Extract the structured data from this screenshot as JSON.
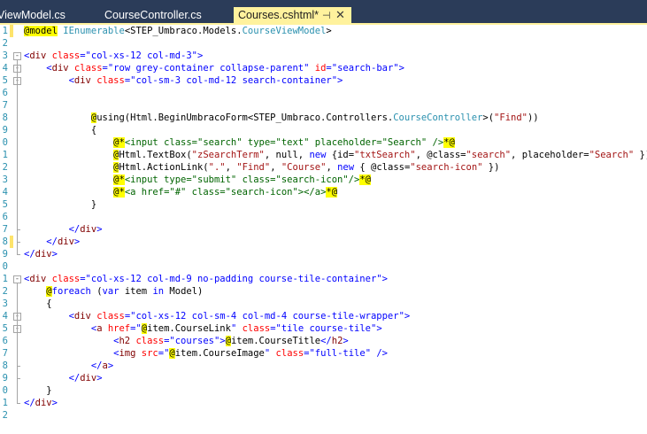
{
  "tabs": [
    {
      "label": "ViewModel.cs",
      "active": false
    },
    {
      "label": "CourseController.cs",
      "active": false
    },
    {
      "label": "Courses.cshtml*",
      "active": true
    }
  ],
  "tab_controls": {
    "pin": "⊣",
    "close": "✕"
  },
  "colors": {
    "tabbar": "#2b3c59",
    "active_tab": "#fff29d",
    "line_numbers": "#2b91af",
    "tag": "#800000",
    "attribute": "#ff0000",
    "attribute_value": "#0000ff",
    "string": "#a31515",
    "type": "#2b91af",
    "razor_highlight": "#ffff00",
    "modified_marker": "#fee46b"
  },
  "lines": [
    {
      "n": "1",
      "mod": true,
      "fold": "",
      "tokens": [
        [
          "rz",
          "@model"
        ],
        [
          "",
          " "
        ],
        [
          "ty",
          "IEnumerable"
        ],
        [
          "",
          "<STEP_Umbraco.Models."
        ],
        [
          "ty",
          "CourseViewModel"
        ],
        [
          "",
          ">"
        ]
      ]
    },
    {
      "n": "2",
      "mod": false,
      "fold": "",
      "tokens": []
    },
    {
      "n": "3",
      "mod": false,
      "fold": "-",
      "tokens": [
        [
          "av",
          "<"
        ],
        [
          "tg",
          "div"
        ],
        [
          "",
          " "
        ],
        [
          "at",
          "class"
        ],
        [
          "av",
          "=\"col-xs-12 col-md-3\">"
        ]
      ]
    },
    {
      "n": "4",
      "mod": false,
      "fold": "-",
      "tokens": [
        [
          "",
          "    "
        ],
        [
          "av",
          "<"
        ],
        [
          "tg",
          "div"
        ],
        [
          "",
          " "
        ],
        [
          "at",
          "class"
        ],
        [
          "av",
          "=\"row grey-container collapse-parent\""
        ],
        [
          "",
          " "
        ],
        [
          "at",
          "id"
        ],
        [
          "av",
          "=\"search-bar\">"
        ]
      ]
    },
    {
      "n": "5",
      "mod": false,
      "fold": "-",
      "tokens": [
        [
          "",
          "        "
        ],
        [
          "av",
          "<"
        ],
        [
          "tg",
          "div"
        ],
        [
          "",
          " "
        ],
        [
          "at",
          "class"
        ],
        [
          "av",
          "=\"col-sm-3 col-md-12 search-container\">"
        ]
      ]
    },
    {
      "n": "6",
      "mod": false,
      "fold": "",
      "tokens": []
    },
    {
      "n": "7",
      "mod": false,
      "fold": "",
      "tokens": []
    },
    {
      "n": "8",
      "mod": false,
      "fold": "",
      "tokens": [
        [
          "",
          "            "
        ],
        [
          "rz",
          "@"
        ],
        [
          "",
          "using(Html.BeginUmbracoForm<STEP_Umbraco.Controllers."
        ],
        [
          "ty",
          "CourseController"
        ],
        [
          "",
          ">("
        ],
        [
          "st",
          "\"Find\""
        ],
        [
          "",
          "))"
        ]
      ]
    },
    {
      "n": "9",
      "mod": false,
      "fold": "",
      "tokens": [
        [
          "",
          "            {"
        ]
      ]
    },
    {
      "n": "0",
      "mod": false,
      "fold": "",
      "tokens": [
        [
          "",
          "                "
        ],
        [
          "rz",
          "@*"
        ],
        [
          "cm",
          "<input class=\"search\" type=\"text\" placeholder=\"Search\" />"
        ],
        [
          "rz",
          "*@"
        ]
      ]
    },
    {
      "n": "1",
      "mod": false,
      "fold": "",
      "tokens": [
        [
          "",
          "                "
        ],
        [
          "rz",
          "@"
        ],
        [
          "",
          "Html.TextBox("
        ],
        [
          "st",
          "\"zSearchTerm\""
        ],
        [
          "",
          ", null, "
        ],
        [
          "av",
          "new"
        ],
        [
          "",
          " {id="
        ],
        [
          "st",
          "\"txtSearch\""
        ],
        [
          "",
          ", @class="
        ],
        [
          "st",
          "\"search\""
        ],
        [
          "",
          ", placeholder="
        ],
        [
          "st",
          "\"Search\""
        ],
        [
          "",
          " })"
        ]
      ]
    },
    {
      "n": "2",
      "mod": false,
      "fold": "",
      "tokens": [
        [
          "",
          "                "
        ],
        [
          "rz",
          "@"
        ],
        [
          "",
          "Html.ActionLink("
        ],
        [
          "st",
          "\".\""
        ],
        [
          "",
          ", "
        ],
        [
          "st",
          "\"Find\""
        ],
        [
          "",
          ", "
        ],
        [
          "st",
          "\"Course\""
        ],
        [
          "",
          ", "
        ],
        [
          "av",
          "new"
        ],
        [
          "",
          " { @class="
        ],
        [
          "st",
          "\"search-icon\""
        ],
        [
          "",
          " })"
        ]
      ]
    },
    {
      "n": "3",
      "mod": false,
      "fold": "",
      "tokens": [
        [
          "",
          "                "
        ],
        [
          "rz",
          "@*"
        ],
        [
          "cm",
          "<input type=\"submit\" class=\"search-icon\"/>"
        ],
        [
          "rz",
          "*@"
        ]
      ]
    },
    {
      "n": "4",
      "mod": false,
      "fold": "",
      "tokens": [
        [
          "",
          "                "
        ],
        [
          "rz",
          "@*"
        ],
        [
          "cm",
          "<a href=\"#\" class=\"search-icon\"></a>"
        ],
        [
          "rz",
          "*@"
        ]
      ]
    },
    {
      "n": "5",
      "mod": false,
      "fold": "",
      "tokens": [
        [
          "",
          "            }"
        ]
      ]
    },
    {
      "n": "6",
      "mod": false,
      "fold": "",
      "tokens": []
    },
    {
      "n": "7",
      "mod": false,
      "fold": "",
      "tokens": [
        [
          "",
          "        "
        ],
        [
          "av",
          "</"
        ],
        [
          "tg",
          "div"
        ],
        [
          "av",
          ">"
        ]
      ]
    },
    {
      "n": "8",
      "mod": true,
      "fold": "",
      "tokens": [
        [
          "",
          "    "
        ],
        [
          "av",
          "</"
        ],
        [
          "tg",
          "div"
        ],
        [
          "av",
          ">"
        ]
      ]
    },
    {
      "n": "9",
      "mod": false,
      "fold": "",
      "tokens": [
        [
          "av",
          "</"
        ],
        [
          "tg",
          "div"
        ],
        [
          "av",
          ">"
        ]
      ]
    },
    {
      "n": "0",
      "mod": false,
      "fold": "",
      "tokens": []
    },
    {
      "n": "1",
      "mod": false,
      "fold": "-",
      "tokens": [
        [
          "av",
          "<"
        ],
        [
          "tg",
          "div"
        ],
        [
          "",
          " "
        ],
        [
          "at",
          "class"
        ],
        [
          "av",
          "=\"col-xs-12 col-md-9 no-padding course-tile-container\">"
        ]
      ]
    },
    {
      "n": "2",
      "mod": false,
      "fold": "",
      "tokens": [
        [
          "",
          "    "
        ],
        [
          "rz",
          "@"
        ],
        [
          "av",
          "foreach"
        ],
        [
          "",
          " ("
        ],
        [
          "av",
          "var"
        ],
        [
          "",
          " item "
        ],
        [
          "av",
          "in"
        ],
        [
          "",
          " Model)"
        ]
      ]
    },
    {
      "n": "3",
      "mod": false,
      "fold": "",
      "tokens": [
        [
          "",
          "    {"
        ]
      ]
    },
    {
      "n": "4",
      "mod": false,
      "fold": "-",
      "tokens": [
        [
          "",
          "        "
        ],
        [
          "av",
          "<"
        ],
        [
          "tg",
          "div"
        ],
        [
          "",
          " "
        ],
        [
          "at",
          "class"
        ],
        [
          "av",
          "=\"col-xs-12 col-sm-4 col-md-4 course-tile-wrapper\">"
        ]
      ]
    },
    {
      "n": "5",
      "mod": false,
      "fold": "-",
      "tokens": [
        [
          "",
          "            "
        ],
        [
          "av",
          "<"
        ],
        [
          "tg",
          "a"
        ],
        [
          "",
          " "
        ],
        [
          "at",
          "href"
        ],
        [
          "av",
          "=\""
        ],
        [
          "rz",
          "@"
        ],
        [
          "",
          "item.CourseLink"
        ],
        [
          "av",
          "\""
        ],
        [
          "",
          " "
        ],
        [
          "at",
          "class"
        ],
        [
          "av",
          "=\"tile course-tile\">"
        ]
      ]
    },
    {
      "n": "6",
      "mod": false,
      "fold": "",
      "tokens": [
        [
          "",
          "                "
        ],
        [
          "av",
          "<"
        ],
        [
          "tg",
          "h2"
        ],
        [
          "",
          " "
        ],
        [
          "at",
          "class"
        ],
        [
          "av",
          "=\"courses\">"
        ],
        [
          "rz",
          "@"
        ],
        [
          "",
          "item.CourseTitle"
        ],
        [
          "av",
          "</"
        ],
        [
          "tg",
          "h2"
        ],
        [
          "av",
          ">"
        ]
      ]
    },
    {
      "n": "7",
      "mod": false,
      "fold": "",
      "tokens": [
        [
          "",
          "                "
        ],
        [
          "av",
          "<"
        ],
        [
          "tg",
          "img"
        ],
        [
          "",
          " "
        ],
        [
          "at",
          "src"
        ],
        [
          "av",
          "=\""
        ],
        [
          "rz",
          "@"
        ],
        [
          "",
          "item.CourseImage"
        ],
        [
          "av",
          "\""
        ],
        [
          "",
          " "
        ],
        [
          "at",
          "class"
        ],
        [
          "av",
          "=\"full-tile\""
        ],
        [
          "",
          " "
        ],
        [
          "av",
          "/>"
        ]
      ]
    },
    {
      "n": "8",
      "mod": false,
      "fold": "",
      "tokens": [
        [
          "",
          "            "
        ],
        [
          "av",
          "</"
        ],
        [
          "tg",
          "a"
        ],
        [
          "av",
          ">"
        ]
      ]
    },
    {
      "n": "9",
      "mod": false,
      "fold": "",
      "tokens": [
        [
          "",
          "        "
        ],
        [
          "av",
          "</"
        ],
        [
          "tg",
          "div"
        ],
        [
          "av",
          ">"
        ]
      ]
    },
    {
      "n": "0",
      "mod": false,
      "fold": "",
      "tokens": [
        [
          "",
          "    }"
        ]
      ]
    },
    {
      "n": "1",
      "mod": false,
      "fold": "",
      "tokens": [
        [
          "av",
          "</"
        ],
        [
          "tg",
          "div"
        ],
        [
          "av",
          ">"
        ]
      ]
    },
    {
      "n": "2",
      "mod": false,
      "fold": "",
      "tokens": []
    }
  ]
}
